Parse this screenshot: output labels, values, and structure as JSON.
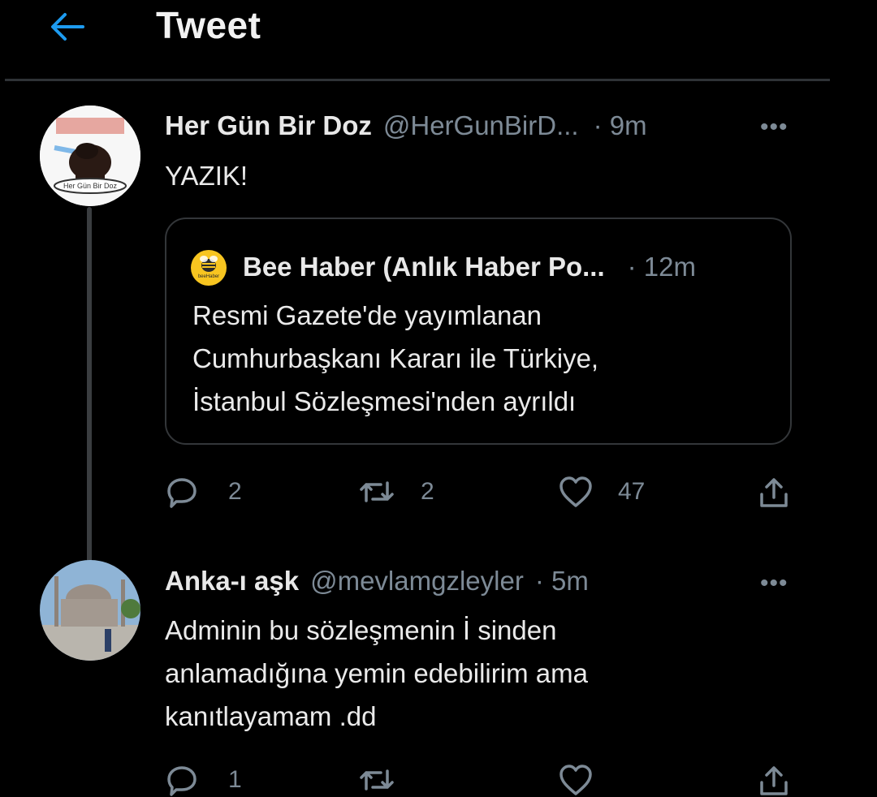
{
  "header": {
    "title": "Tweet"
  },
  "tweet": {
    "name": "Her Gün Bir Doz",
    "handle": "@HerGunBirD...",
    "time": "· 9m",
    "text": "YAZIK!",
    "avatar_caption": "Her Gün Bir Doz",
    "quote": {
      "name": "Bee Haber (Anlık Haber Po...",
      "time": "· 12m",
      "logo_text": "beeHaber",
      "lines": [
        "Resmi Gazete'de yayımlanan",
        "Cumhurbaşkanı Kararı ile Türkiye,",
        "İstanbul Sözleşmesi'nden ayrıldı"
      ]
    },
    "actions": {
      "replies": "2",
      "retweets": "2",
      "likes": "47"
    }
  },
  "reply": {
    "name": "Anka-ı aşk",
    "handle": "@mevlamgzleyler",
    "time": "· 5m",
    "lines": [
      "Adminin bu sözleşmenin İ sinden",
      "anlamadığına yemin edebilirim ama",
      "kanıtlayamam .dd"
    ],
    "actions": {
      "replies": "1",
      "retweets": "",
      "likes": ""
    }
  },
  "more_label": "•••",
  "colors": {
    "accent": "#1d9bf0",
    "muted": "#7d8a96",
    "border": "#333639",
    "background": "#000000"
  }
}
